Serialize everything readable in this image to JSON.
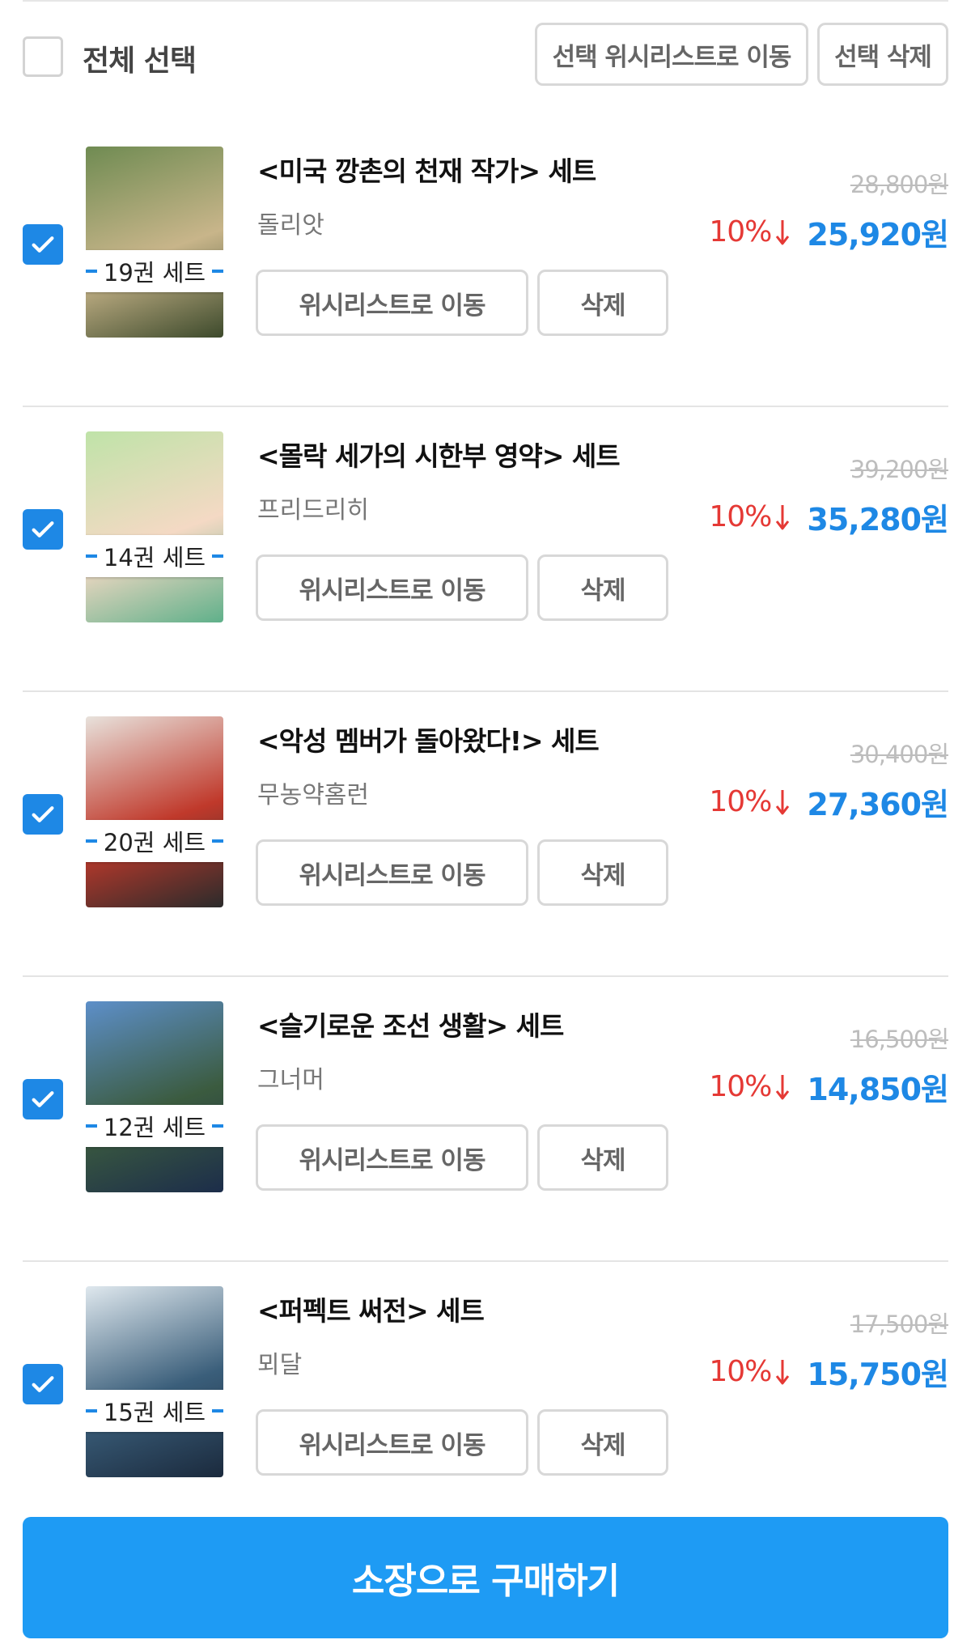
{
  "header": {
    "select_all_label": "전체 선택",
    "select_all_checked": false,
    "move_selected_label": "선택 위시리스트로 이동",
    "delete_selected_label": "선택 삭제"
  },
  "items": [
    {
      "title": "<미국 깡촌의 천재 작가> 세트",
      "author": "돌리앗",
      "volume_badge": "19권 세트",
      "original_price": "28,800원",
      "discount": "10%",
      "sale_price": "25,920원",
      "checked": true,
      "move_label": "위시리스트로 이동",
      "delete_label": "삭제",
      "cover_colors": [
        "#6f8b52",
        "#c8b58a",
        "#3d4a2c"
      ]
    },
    {
      "title": "<몰락 세가의 시한부 영약> 세트",
      "author": "프리드리히",
      "volume_badge": "14권 세트",
      "original_price": "39,200원",
      "discount": "10%",
      "sale_price": "35,280원",
      "checked": true,
      "move_label": "위시리스트로 이동",
      "delete_label": "삭제",
      "cover_colors": [
        "#bfe3a8",
        "#f4d9c4",
        "#5fb08a"
      ]
    },
    {
      "title": "<악성 멤버가 돌아왔다!> 세트",
      "author": "무농약홈런",
      "volume_badge": "20권 세트",
      "original_price": "30,400원",
      "discount": "10%",
      "sale_price": "27,360원",
      "checked": true,
      "move_label": "위시리스트로 이동",
      "delete_label": "삭제",
      "cover_colors": [
        "#e8e2dc",
        "#c0392b",
        "#2b2b2b"
      ]
    },
    {
      "title": "<슬기로운 조선 생활> 세트",
      "author": "그너머",
      "volume_badge": "12권 세트",
      "original_price": "16,500원",
      "discount": "10%",
      "sale_price": "14,850원",
      "checked": true,
      "move_label": "위시리스트로 이동",
      "delete_label": "삭제",
      "cover_colors": [
        "#5d8fc9",
        "#3b5b3f",
        "#1c2d4a"
      ]
    },
    {
      "title": "<퍼펙트 써전> 세트",
      "author": "뫼달",
      "volume_badge": "15권 세트",
      "original_price": "17,500원",
      "discount": "10%",
      "sale_price": "15,750원",
      "checked": true,
      "move_label": "위시리스트로 이동",
      "delete_label": "삭제",
      "cover_colors": [
        "#dfe8ee",
        "#3a5e7a",
        "#1b2a3d"
      ]
    }
  ],
  "buy_button_label": "소장으로 구매하기",
  "colors": {
    "accent": "#1e88e5",
    "buy_button": "#1e9bf4",
    "discount_red": "#e53935"
  },
  "icons": {
    "check": "check-icon",
    "down_arrow": "down-arrow-icon"
  }
}
